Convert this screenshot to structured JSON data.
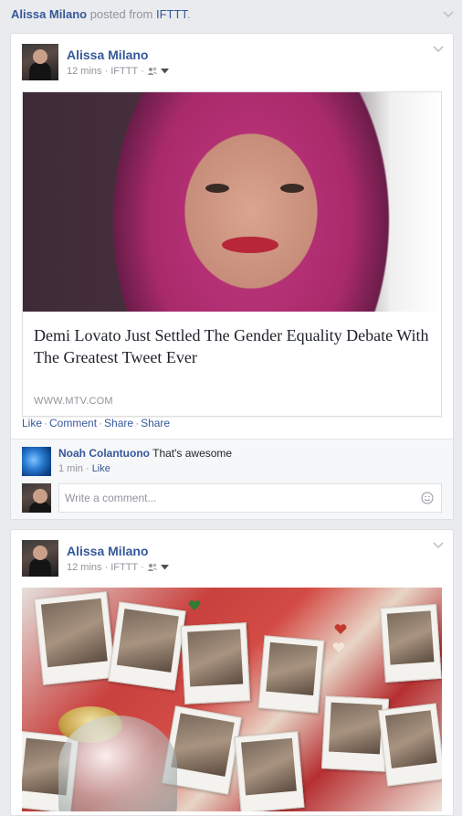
{
  "story": {
    "actor": "Alissa Milano",
    "posted_from_text": "posted from",
    "source": "IFTTT",
    "period": "."
  },
  "post1": {
    "author": "Alissa Milano",
    "time": "12 mins",
    "via": "IFTTT",
    "link": {
      "title": "Demi Lovato Just Settled The Gender Equality Debate With The Greatest Tweet Ever",
      "domain": "WWW.MTV.COM"
    },
    "actions": {
      "like": "Like",
      "comment": "Comment",
      "share1": "Share",
      "share2": "Share"
    },
    "comment": {
      "author": "Noah Colantuono",
      "text": "That's awesome",
      "time": "1 min",
      "like": "Like"
    },
    "comment_placeholder": "Write a comment..."
  },
  "post2": {
    "author": "Alissa Milano",
    "time": "12 mins",
    "via": "IFTTT"
  },
  "colors": {
    "link_blue": "#365899",
    "meta_gray": "#90949c",
    "background": "#e9ebee"
  },
  "icons": {
    "audience": "friends-icon",
    "menu": "chevron-down-icon",
    "emoji": "smiley-icon"
  }
}
